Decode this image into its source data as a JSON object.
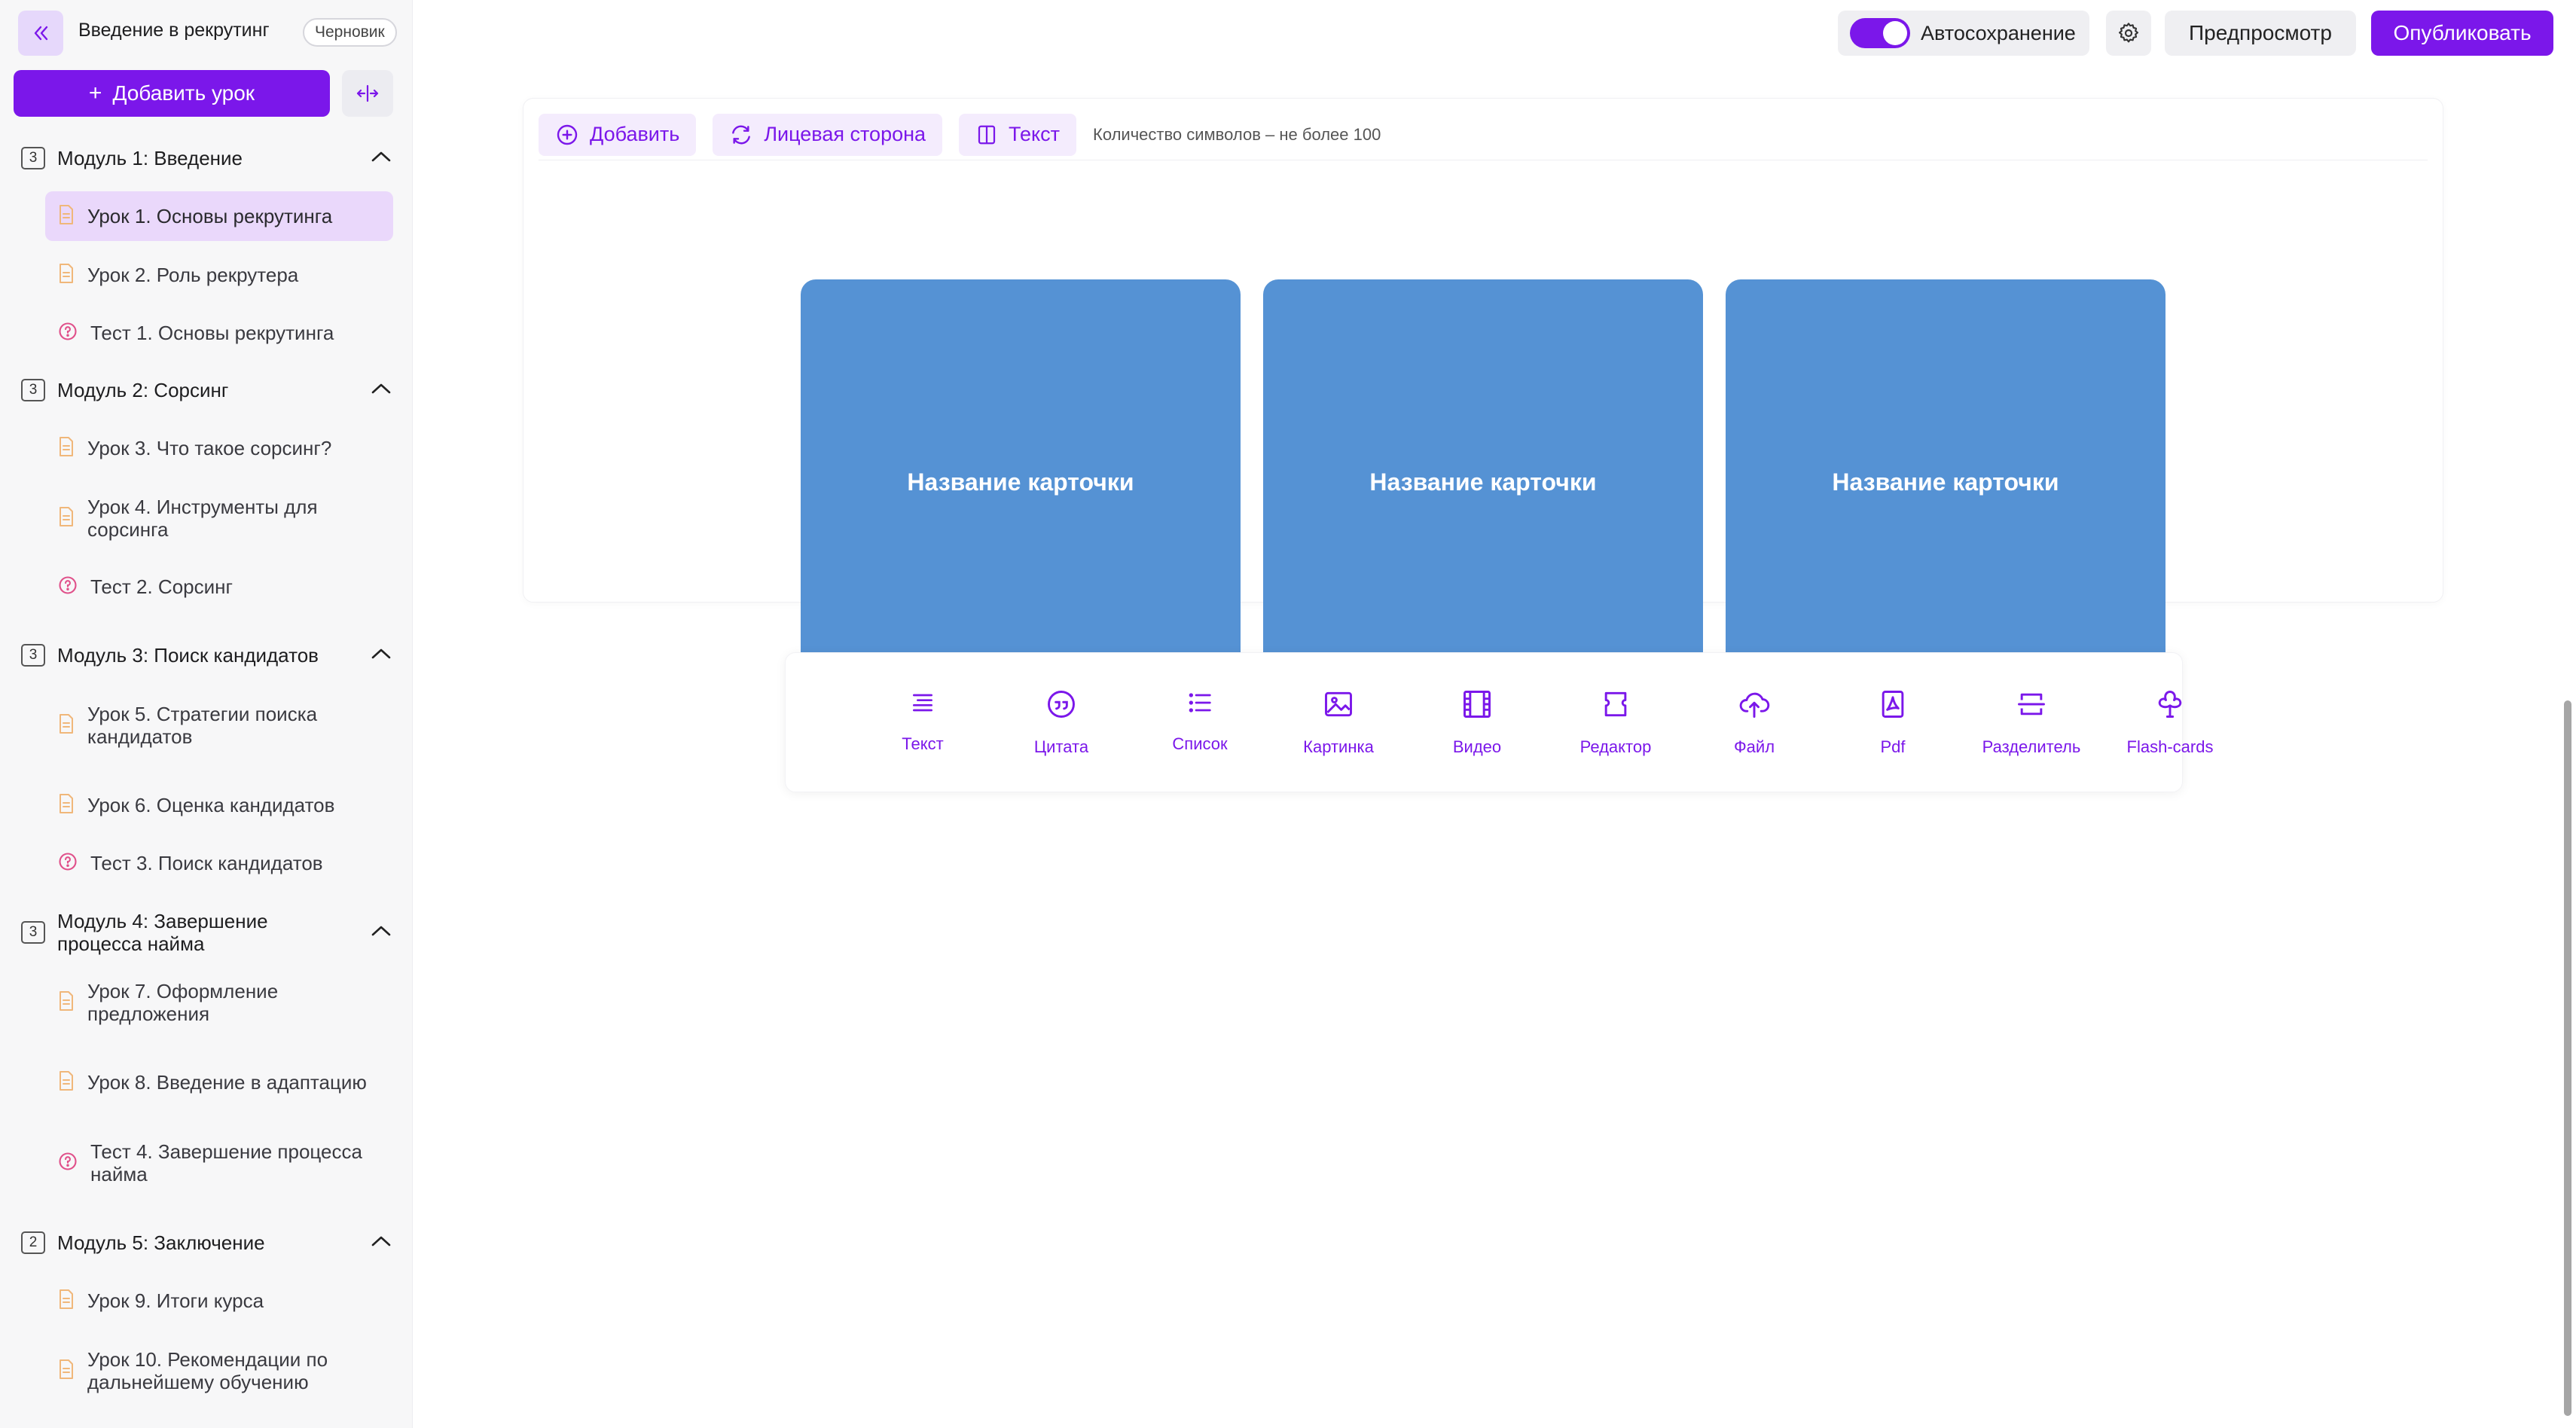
{
  "header": {
    "course_title": "Введение в рекрутинг",
    "status_badge": "Черновик",
    "autosave_label": "Автосохранение",
    "autosave_on": true,
    "preview_label": "Предпросмотр",
    "publish_label": "Опубликовать"
  },
  "sidebar": {
    "add_lesson_label": "Добавить урок",
    "modules": [
      {
        "count": "3",
        "title": "Модуль 1: Введение",
        "items": [
          {
            "type": "lesson",
            "title": "Урок 1. Основы рекрутинга",
            "active": true
          },
          {
            "type": "lesson",
            "title": "Урок 2. Роль рекрутера"
          },
          {
            "type": "test",
            "title": "Тест 1. Основы рекрутинга"
          }
        ]
      },
      {
        "count": "3",
        "title": "Модуль 2: Сорсинг",
        "items": [
          {
            "type": "lesson",
            "title": "Урок 3. Что такое сорсинг?"
          },
          {
            "type": "lesson",
            "title": "Урок 4. Инструменты для сорсинга"
          },
          {
            "type": "test",
            "title": "Тест 2. Сорсинг"
          }
        ]
      },
      {
        "count": "3",
        "title": "Модуль 3: Поиск кандидатов",
        "items": [
          {
            "type": "lesson",
            "title": "Урок 5. Стратегии поиска кандидатов"
          },
          {
            "type": "lesson",
            "title": "Урок 6. Оценка кандидатов"
          },
          {
            "type": "test",
            "title": "Тест 3. Поиск кандидатов"
          }
        ]
      },
      {
        "count": "3",
        "title": "Модуль 4: Завершение процесса найма",
        "items": [
          {
            "type": "lesson",
            "title": "Урок 7. Оформление предложения"
          },
          {
            "type": "lesson",
            "title": "Урок 8. Введение в адаптацию"
          },
          {
            "type": "test",
            "title": "Тест 4. Завершение процесса найма"
          }
        ]
      },
      {
        "count": "2",
        "title": "Модуль 5: Заключение",
        "items": [
          {
            "type": "lesson",
            "title": "Урок 9. Итоги курса"
          },
          {
            "type": "lesson",
            "title": "Урок 10. Рекомендации по дальнейшему обучению"
          }
        ]
      }
    ]
  },
  "editor": {
    "add_label": "Добавить",
    "front_side_label": "Лицевая сторона",
    "text_label": "Текст",
    "char_hint": "Количество символов – не более 100",
    "cards": [
      "Название карточки",
      "Название карточки",
      "Название карточки"
    ],
    "card_color": "#5592d4"
  },
  "insert_toolbar": [
    {
      "label": "Текст",
      "icon": "text-lines-icon"
    },
    {
      "label": "Цитата",
      "icon": "quote-icon"
    },
    {
      "label": "Список",
      "icon": "list-icon"
    },
    {
      "label": "Картинка",
      "icon": "image-icon"
    },
    {
      "label": "Видео",
      "icon": "film-icon"
    },
    {
      "label": "Редактор",
      "icon": "editor-icon"
    },
    {
      "label": "Файл",
      "icon": "cloud-upload-icon"
    },
    {
      "label": "Pdf",
      "icon": "pdf-icon"
    },
    {
      "label": "Разделитель",
      "icon": "divider-icon"
    },
    {
      "label": "Flash-cards",
      "icon": "clover-icon"
    }
  ],
  "colors": {
    "accent": "#7b17ea",
    "accent_light": "#ead8fb",
    "lesson_icon": "#f0b77a",
    "test_icon": "#e0508a"
  }
}
